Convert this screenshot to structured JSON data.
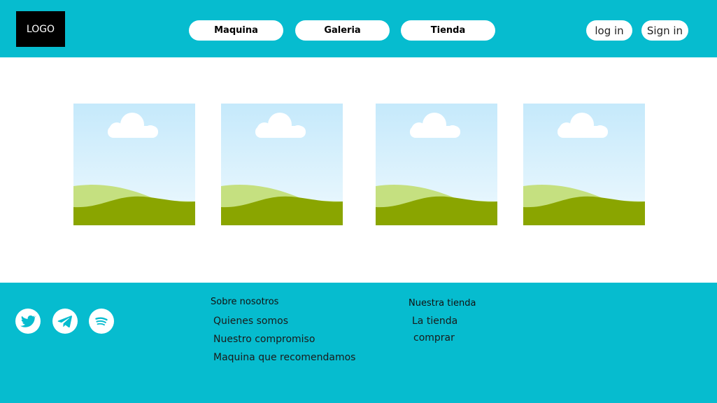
{
  "header": {
    "logo": "LOGO",
    "nav": [
      {
        "label": "Maquina"
      },
      {
        "label": "Galeria"
      },
      {
        "label": "Tienda"
      }
    ],
    "login_label": "log in",
    "signin_label": "Sign in",
    "background_color": "#06bccf"
  },
  "gallery": {
    "images": [
      {
        "icon": "landscape-placeholder-image"
      },
      {
        "icon": "landscape-placeholder-image"
      },
      {
        "icon": "landscape-placeholder-image"
      },
      {
        "icon": "landscape-placeholder-image"
      }
    ]
  },
  "footer": {
    "social": [
      {
        "icon": "twitter-icon"
      },
      {
        "icon": "telegram-icon"
      },
      {
        "icon": "spotify-icon"
      }
    ],
    "sections": [
      {
        "heading": "Sobre nosotros",
        "links": [
          "Quienes somos",
          "Nuestro compromiso",
          "Maquina que recomendamos"
        ]
      },
      {
        "heading": "Nuestra tienda",
        "links": [
          "La tienda",
          "comprar"
        ]
      }
    ],
    "background_color": "#06bccf"
  }
}
